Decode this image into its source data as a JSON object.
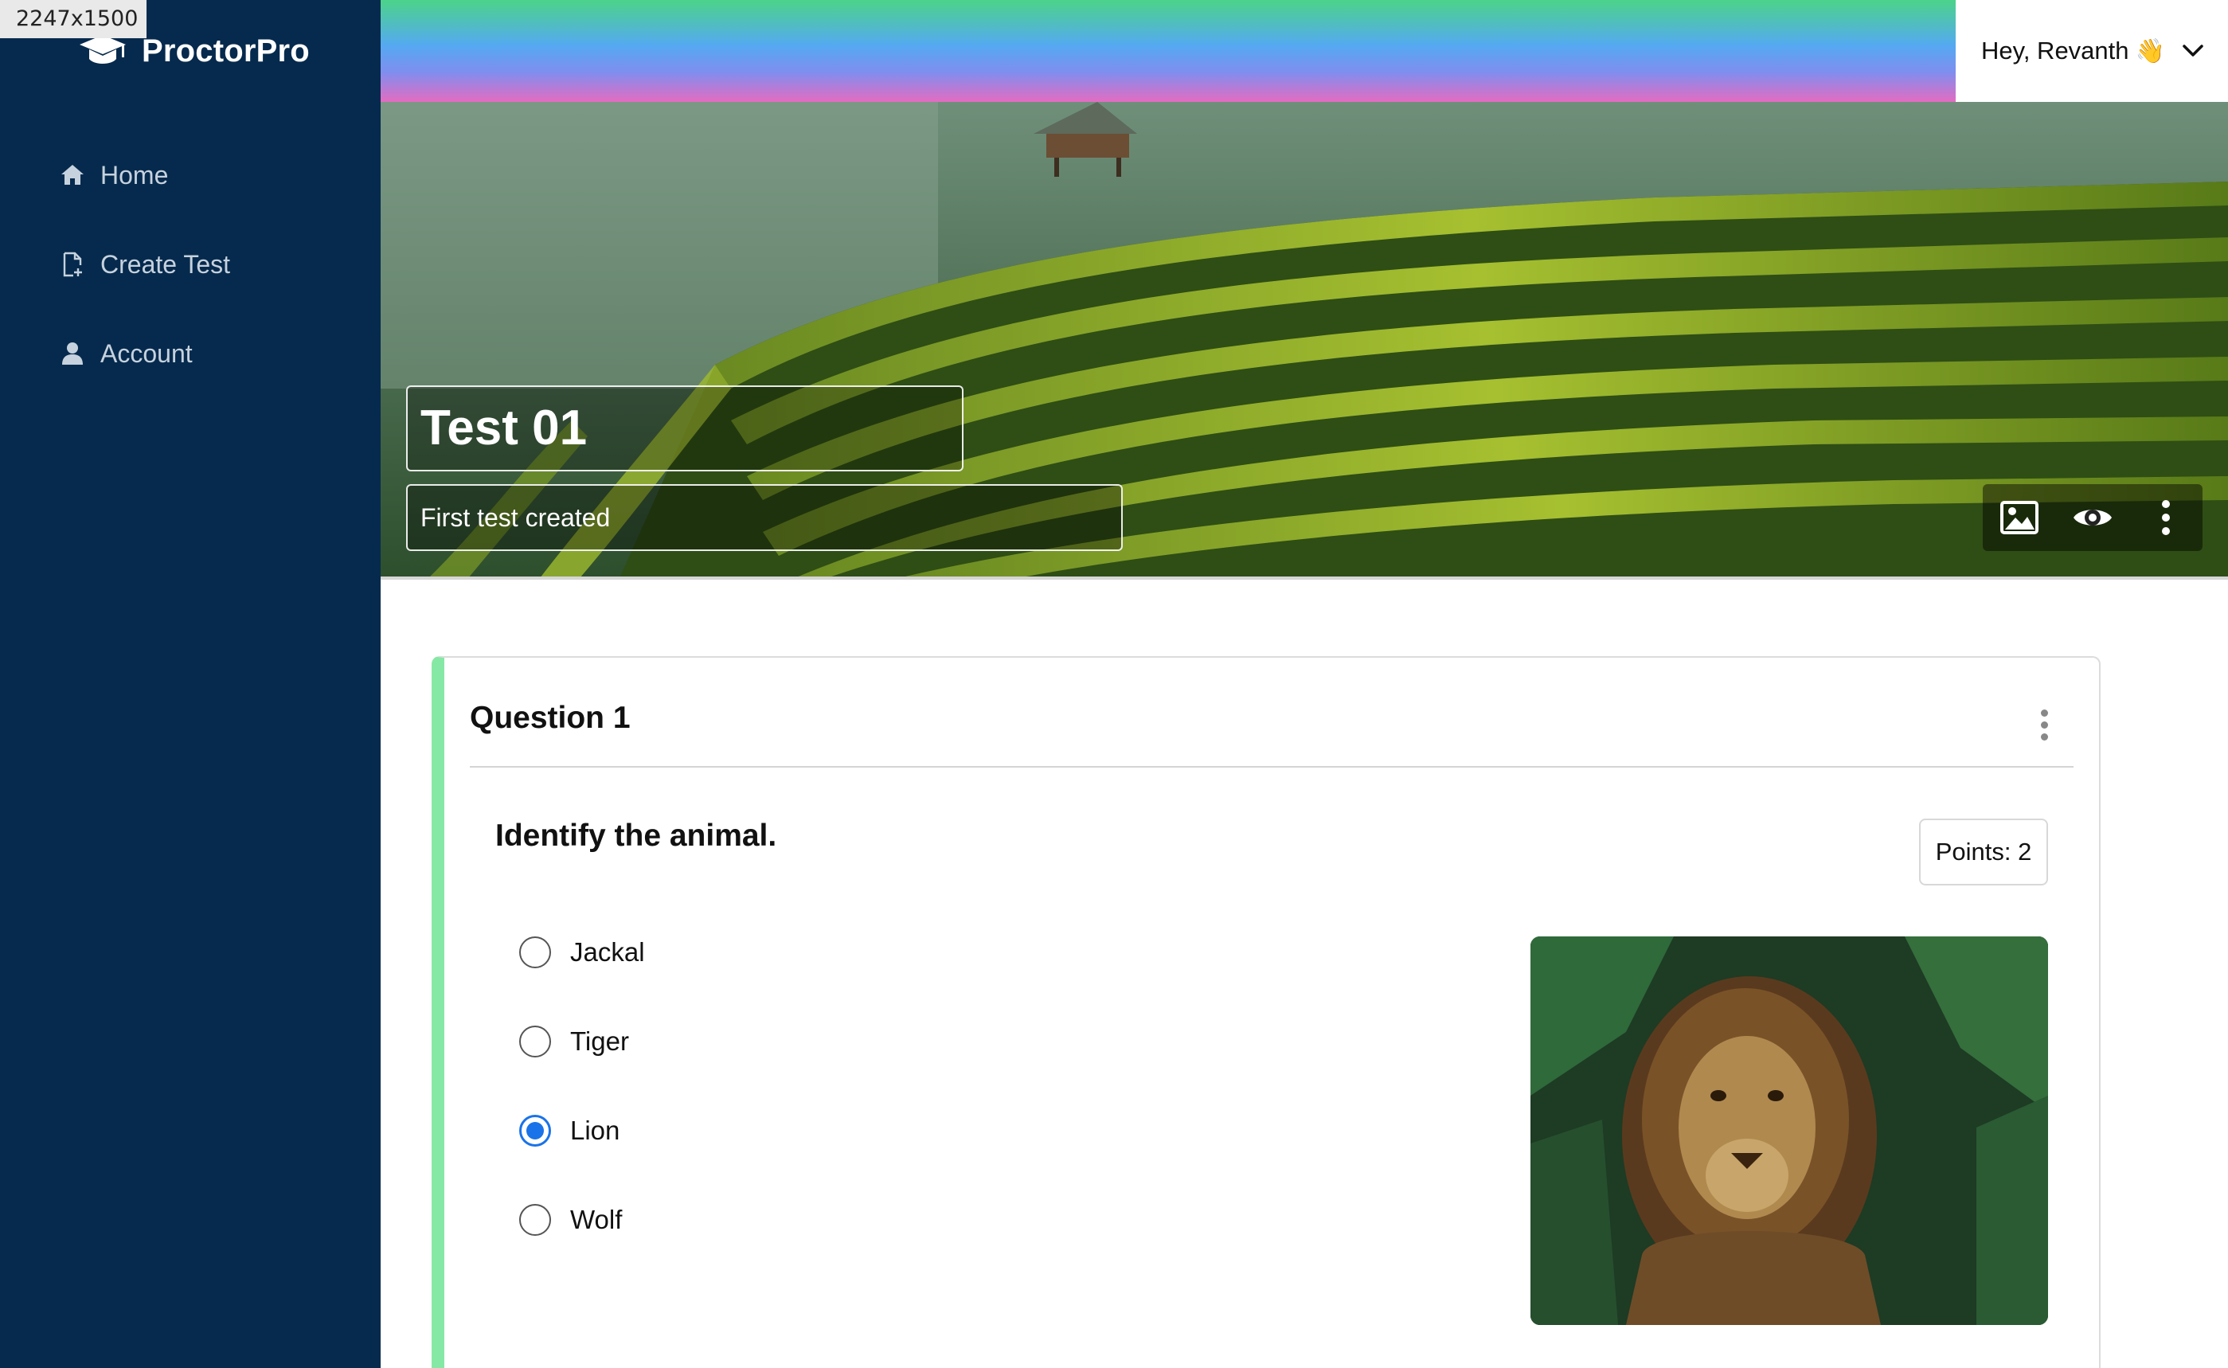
{
  "overlay": {
    "size_label": "2247x1500"
  },
  "brand": {
    "name": "ProctorPro",
    "icon": "graduation-cap-icon"
  },
  "sidebar": {
    "items": [
      {
        "label": "Home",
        "icon": "home-icon"
      },
      {
        "label": "Create Test",
        "icon": "file-plus-icon"
      },
      {
        "label": "Account",
        "icon": "user-icon"
      }
    ]
  },
  "header": {
    "greeting": "Hey, Revanth",
    "emoji": "👋",
    "dropdown_icon": "chevron-down-icon"
  },
  "banner": {
    "title": "Test 01",
    "description": "First test created",
    "tools": [
      "image-icon",
      "eye-icon",
      "more-vertical-icon"
    ]
  },
  "question": {
    "header": "Question 1",
    "text": "Identify the animal.",
    "points_label": "Points: 2",
    "options": [
      {
        "label": "Jackal",
        "selected": false
      },
      {
        "label": "Tiger",
        "selected": false
      },
      {
        "label": "Lion",
        "selected": true
      },
      {
        "label": "Wolf",
        "selected": false
      }
    ],
    "image": "lion-photo"
  },
  "colors": {
    "sidebar_bg": "#062a4d",
    "accent_green": "#86e8a5",
    "radio_selected": "#1a73e8"
  }
}
